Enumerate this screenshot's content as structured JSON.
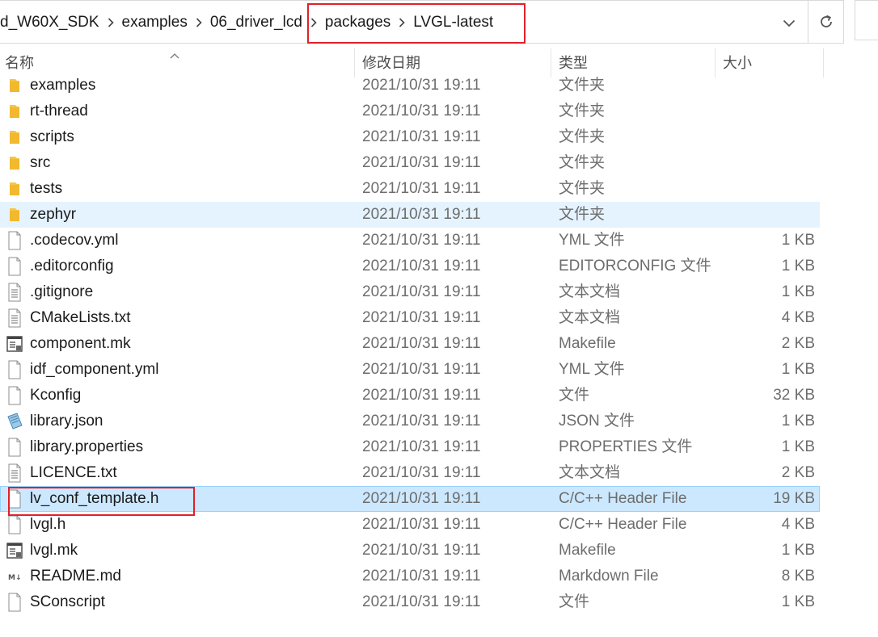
{
  "breadcrumb": [
    "d_W60X_SDK",
    "examples",
    "06_driver_lcd",
    "packages",
    "LVGL-latest"
  ],
  "header": {
    "name": "名称",
    "date": "修改日期",
    "type": "类型",
    "size": "大小"
  },
  "files": [
    {
      "name": "examples",
      "date": "2021/10/31 19:11",
      "type": "文件夹",
      "size": "",
      "icon": "folder-icon"
    },
    {
      "name": "rt-thread",
      "date": "2021/10/31 19:11",
      "type": "文件夹",
      "size": "",
      "icon": "folder-icon"
    },
    {
      "name": "scripts",
      "date": "2021/10/31 19:11",
      "type": "文件夹",
      "size": "",
      "icon": "folder-icon"
    },
    {
      "name": "src",
      "date": "2021/10/31 19:11",
      "type": "文件夹",
      "size": "",
      "icon": "folder-icon"
    },
    {
      "name": "tests",
      "date": "2021/10/31 19:11",
      "type": "文件夹",
      "size": "",
      "icon": "folder-icon"
    },
    {
      "name": "zephyr",
      "date": "2021/10/31 19:11",
      "type": "文件夹",
      "size": "",
      "icon": "folder-icon",
      "state": "hover"
    },
    {
      "name": ".codecov.yml",
      "date": "2021/10/31 19:11",
      "type": "YML 文件",
      "size": "1 KB",
      "icon": "file-icon"
    },
    {
      "name": ".editorconfig",
      "date": "2021/10/31 19:11",
      "type": "EDITORCONFIG 文件",
      "size": "1 KB",
      "icon": "file-icon"
    },
    {
      "name": ".gitignore",
      "date": "2021/10/31 19:11",
      "type": "文本文档",
      "size": "1 KB",
      "icon": "text-file-icon"
    },
    {
      "name": "CMakeLists.txt",
      "date": "2021/10/31 19:11",
      "type": "文本文档",
      "size": "4 KB",
      "icon": "text-file-icon"
    },
    {
      "name": "component.mk",
      "date": "2021/10/31 19:11",
      "type": "Makefile",
      "size": "2 KB",
      "icon": "makefile-icon"
    },
    {
      "name": "idf_component.yml",
      "date": "2021/10/31 19:11",
      "type": "YML 文件",
      "size": "1 KB",
      "icon": "file-icon"
    },
    {
      "name": "Kconfig",
      "date": "2021/10/31 19:11",
      "type": "文件",
      "size": "32 KB",
      "icon": "file-icon"
    },
    {
      "name": "library.json",
      "date": "2021/10/31 19:11",
      "type": "JSON 文件",
      "size": "1 KB",
      "icon": "json-file-icon"
    },
    {
      "name": "library.properties",
      "date": "2021/10/31 19:11",
      "type": "PROPERTIES 文件",
      "size": "1 KB",
      "icon": "file-icon"
    },
    {
      "name": "LICENCE.txt",
      "date": "2021/10/31 19:11",
      "type": "文本文档",
      "size": "2 KB",
      "icon": "text-file-icon"
    },
    {
      "name": "lv_conf_template.h",
      "date": "2021/10/31 19:11",
      "type": "C/C++ Header File",
      "size": "19 KB",
      "icon": "file-icon",
      "state": "selected"
    },
    {
      "name": "lvgl.h",
      "date": "2021/10/31 19:11",
      "type": "C/C++ Header File",
      "size": "4 KB",
      "icon": "file-icon"
    },
    {
      "name": "lvgl.mk",
      "date": "2021/10/31 19:11",
      "type": "Makefile",
      "size": "1 KB",
      "icon": "makefile-icon"
    },
    {
      "name": "README.md",
      "date": "2021/10/31 19:11",
      "type": "Markdown File",
      "size": "8 KB",
      "icon": "markdown-file-icon"
    },
    {
      "name": "SConscript",
      "date": "2021/10/31 19:11",
      "type": "文件",
      "size": "1 KB",
      "icon": "file-icon"
    }
  ],
  "colors": {
    "highlight_border": "#e0202a",
    "hover_row": "#e5f3ff",
    "selected_row": "#cce8ff",
    "folder": "#f5c645"
  }
}
